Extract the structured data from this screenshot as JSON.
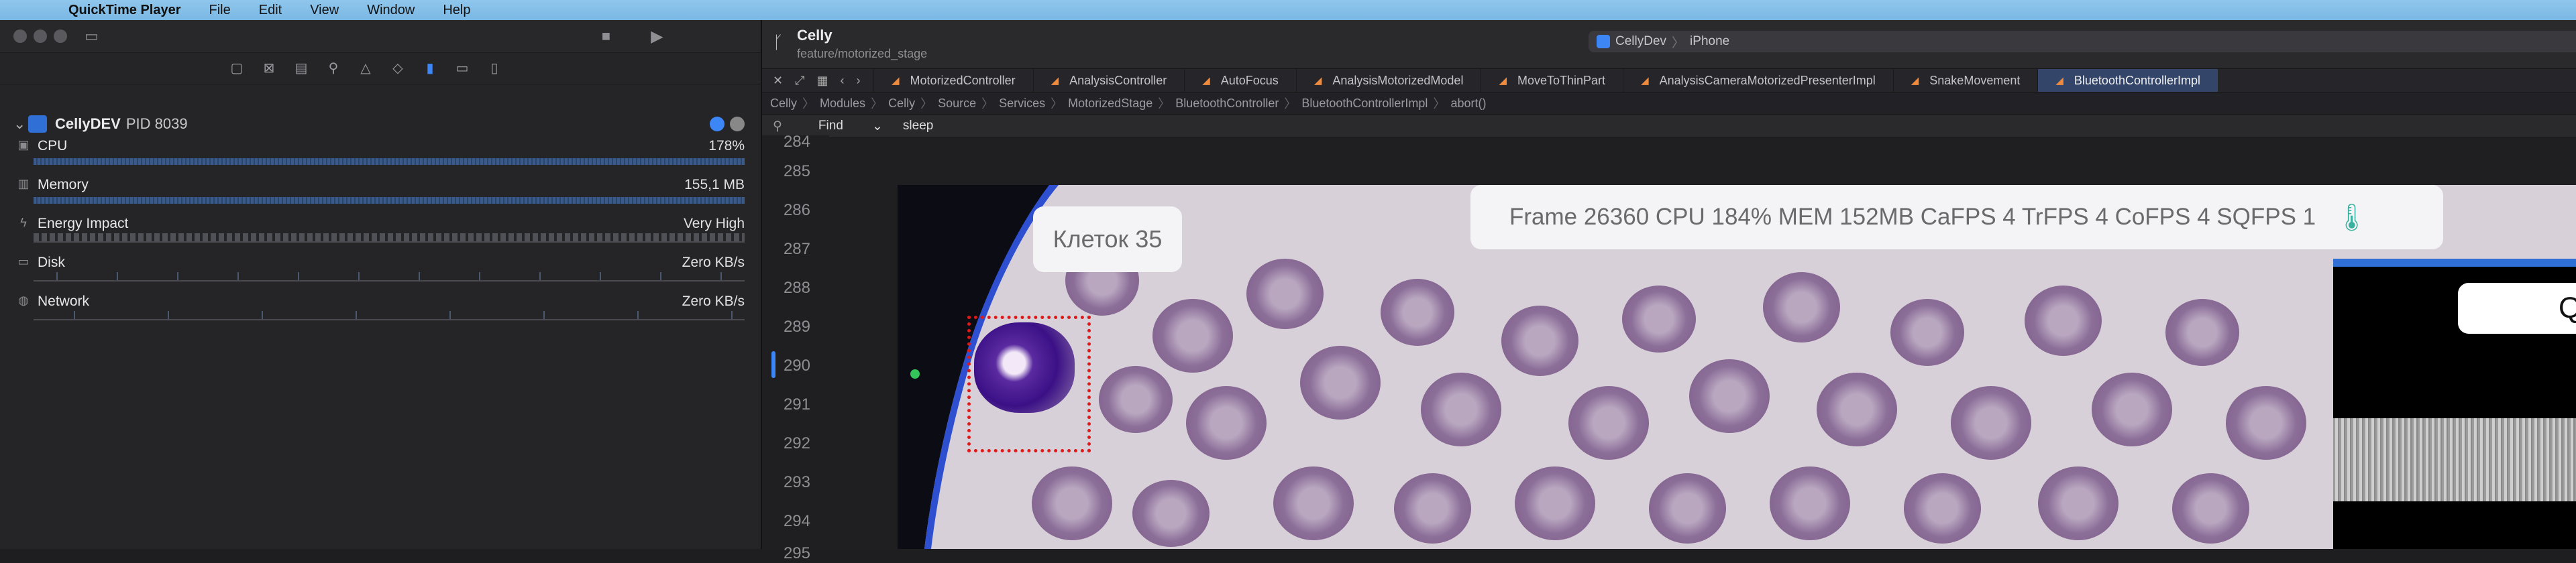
{
  "menubar": {
    "app": "QuickTime Player",
    "items": [
      "File",
      "Edit",
      "View",
      "Window",
      "Help"
    ]
  },
  "navigator": {
    "process": {
      "name": "CellyDEV",
      "pid": "PID 8039"
    },
    "gauges": [
      {
        "label": "CPU",
        "value": "178%",
        "icon": "cpu-icon",
        "fill": 1.0
      },
      {
        "label": "Memory",
        "value": "155,1 MB",
        "icon": "memory-icon",
        "fill": 1.0
      },
      {
        "label": "Energy Impact",
        "value": "Very High",
        "icon": "energy-icon",
        "fill": 0
      },
      {
        "label": "Disk",
        "value": "Zero KB/s",
        "icon": "disk-icon",
        "fill": 0
      },
      {
        "label": "Network",
        "value": "Zero KB/s",
        "icon": "network-icon",
        "fill": 0
      }
    ]
  },
  "editor": {
    "project": "Celly",
    "branch": "feature/motorized_stage",
    "scheme": "CellyDev",
    "destination": "iPhone",
    "tabs": [
      "MotorizedController",
      "AnalysisController",
      "AutoFocus",
      "AnalysisMotorizedModel",
      "MoveToThinPart",
      "AnalysisCameraMotorizedPresenterImpl",
      "SnakeMovement",
      "BluetoothControllerImpl"
    ],
    "active_tab": 7,
    "breadcrumbs": [
      "Celly",
      "Modules",
      "Celly",
      "Source",
      "Services",
      "MotorizedStage",
      "BluetoothController",
      "BluetoothControllerImpl",
      "abort()"
    ],
    "find": {
      "mode": "Find",
      "term": "sleep"
    },
    "line_numbers": [
      "284",
      "285",
      "286",
      "287",
      "288",
      "289",
      "290",
      "291",
      "292",
      "293",
      "294",
      "295"
    ]
  },
  "video": {
    "cell_count": "Клеток 35",
    "stats": "Frame 26360 CPU 184% MEM 152MB  CaFPS 4 TrFPS 4 CoFPS 4 SQFPS 1",
    "overlay_label": "Q"
  },
  "colors": {
    "accent": "#3d86f5",
    "selection": "#e01818",
    "active_tab": "#34456a"
  }
}
